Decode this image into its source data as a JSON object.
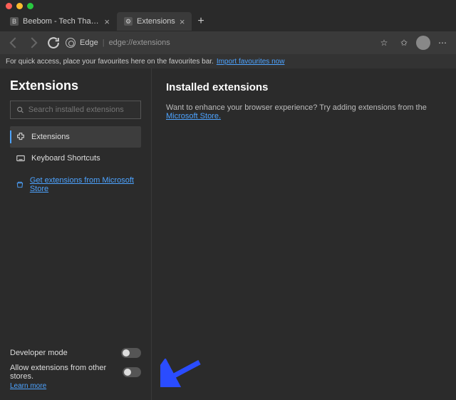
{
  "tabs": [
    {
      "title": "Beebom - Tech That Matters",
      "fav": "B"
    },
    {
      "title": "Extensions",
      "fav": "⚙"
    }
  ],
  "addressbar": {
    "label": "Edge",
    "url": "edge://extensions"
  },
  "favbar": {
    "text": "For quick access, place your favourites here on the favourites bar.",
    "link": "Import favourites now"
  },
  "sidebar": {
    "title": "Extensions",
    "search_placeholder": "Search installed extensions",
    "nav": [
      "Extensions",
      "Keyboard Shortcuts"
    ],
    "store_link": "Get extensions from Microsoft Store",
    "dev_mode": "Developer mode",
    "other_stores": "Allow extensions from other stores.",
    "learn_more": "Learn more"
  },
  "main": {
    "heading": "Installed extensions",
    "body": "Want to enhance your browser experience? Try adding extensions from the ",
    "link": "Microsoft Store."
  },
  "annotation": {
    "arrow_color": "#2a4cff"
  }
}
